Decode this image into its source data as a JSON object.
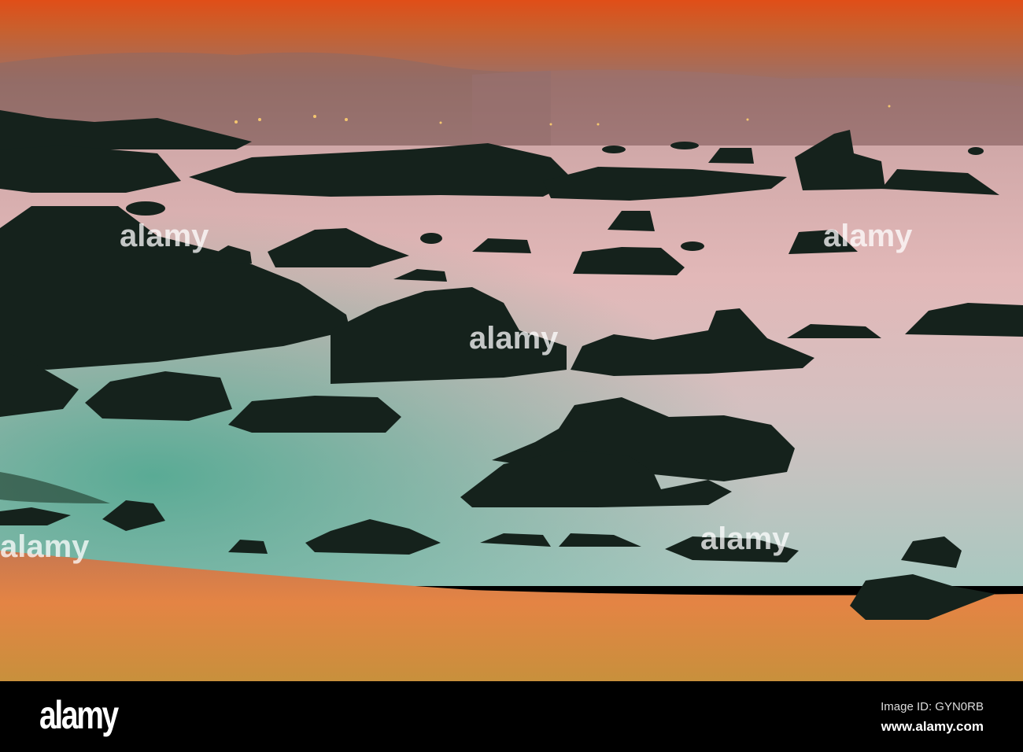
{
  "image": {
    "subject": "rocky beach at sunset"
  },
  "watermark": {
    "text": "alamy"
  },
  "footer": {
    "logo": "alamy",
    "image_id": "Image ID: GYN0RB",
    "website": "www.alamy.com"
  },
  "colors": {
    "sky_top": "#e04e18",
    "haze": "#b07868",
    "water_pink": "#dcb0b4",
    "water_teal": "#6fb2a2",
    "sand": "#e0803e",
    "rock": "#15221c"
  }
}
